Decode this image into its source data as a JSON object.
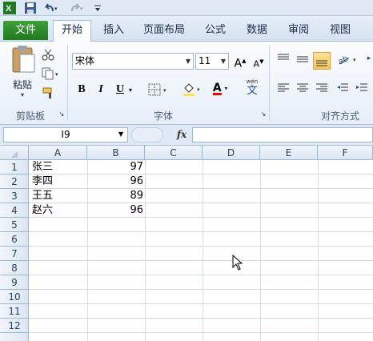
{
  "ribbon_tabs": [
    "文件",
    "开始",
    "插入",
    "页面布局",
    "公式",
    "数据",
    "审阅",
    "视图"
  ],
  "active_tab": "开始",
  "groups": {
    "clipboard": "剪贴板",
    "font": "字体",
    "alignment": "对齐方式"
  },
  "clipboard": {
    "paste_label": "粘贴"
  },
  "font": {
    "family": "宋体",
    "size": "11",
    "bold": "B",
    "italic": "I",
    "underline": "U",
    "font_color_label": "A",
    "phonetic_top": "wén",
    "phonetic_char": "文"
  },
  "formula_bar": {
    "name_box": "I9",
    "fx_label": "fx",
    "formula": ""
  },
  "columns": [
    "A",
    "B",
    "C",
    "D",
    "E",
    "F"
  ],
  "rows": [
    "1",
    "2",
    "3",
    "4",
    "5",
    "6",
    "7",
    "8",
    "9",
    "10",
    "11",
    "12"
  ],
  "cells": [
    {
      "name": "张三",
      "score": "97"
    },
    {
      "name": "李四",
      "score": "96"
    },
    {
      "name": "王五",
      "score": "89"
    },
    {
      "name": "赵六",
      "score": "96"
    }
  ],
  "colors": {
    "file_tab": "#2a8b27",
    "selected_align": "#f8c65a",
    "grid_line": "#d4dbe4",
    "header_bg": "#dbe6f3"
  }
}
